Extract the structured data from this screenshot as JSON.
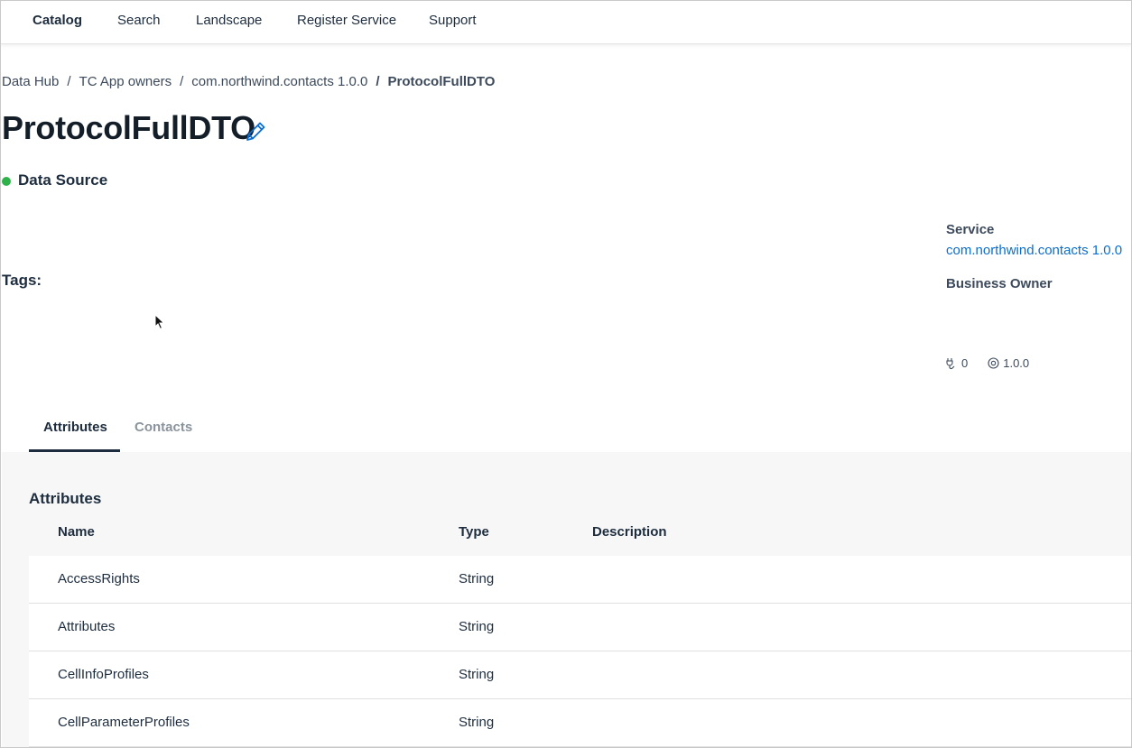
{
  "nav": {
    "items": [
      {
        "label": "Catalog",
        "active": true
      },
      {
        "label": "Search",
        "active": false
      },
      {
        "label": "Landscape",
        "active": false
      },
      {
        "label": "Register Service",
        "active": false
      },
      {
        "label": "Support",
        "active": false
      }
    ]
  },
  "breadcrumb": {
    "items": [
      "Data Hub",
      "TC App owners",
      "com.northwind.contacts 1.0.0"
    ],
    "separator": "/",
    "current": "ProtocolFullDTO"
  },
  "page": {
    "title": "ProtocolFullDTO",
    "edit_icon": "pencil-icon",
    "status": {
      "label": "Data Source",
      "color": "#30b24a"
    },
    "tags_label": "Tags:"
  },
  "sidebar_info": {
    "service_label": "Service",
    "service_value": "com.northwind.contacts 1.0.0",
    "business_owner_label": "Business Owner",
    "connections_icon": "plug-icon",
    "connections_count": "0",
    "version_icon": "version-icon",
    "version": "1.0.0"
  },
  "tabs": [
    {
      "label": "Attributes",
      "active": true
    },
    {
      "label": "Contacts",
      "active": false
    }
  ],
  "attributes": {
    "title": "Attributes",
    "columns": [
      "Name",
      "Type",
      "Description"
    ],
    "rows": [
      {
        "name": "AccessRights",
        "type": "String",
        "description": ""
      },
      {
        "name": "Attributes",
        "type": "String",
        "description": ""
      },
      {
        "name": "CellInfoProfiles",
        "type": "String",
        "description": ""
      },
      {
        "name": "CellParameterProfiles",
        "type": "String",
        "description": ""
      }
    ]
  },
  "colors": {
    "link": "#0a6ed1",
    "status_green": "#30b24a",
    "text": "#1d2d3e"
  }
}
